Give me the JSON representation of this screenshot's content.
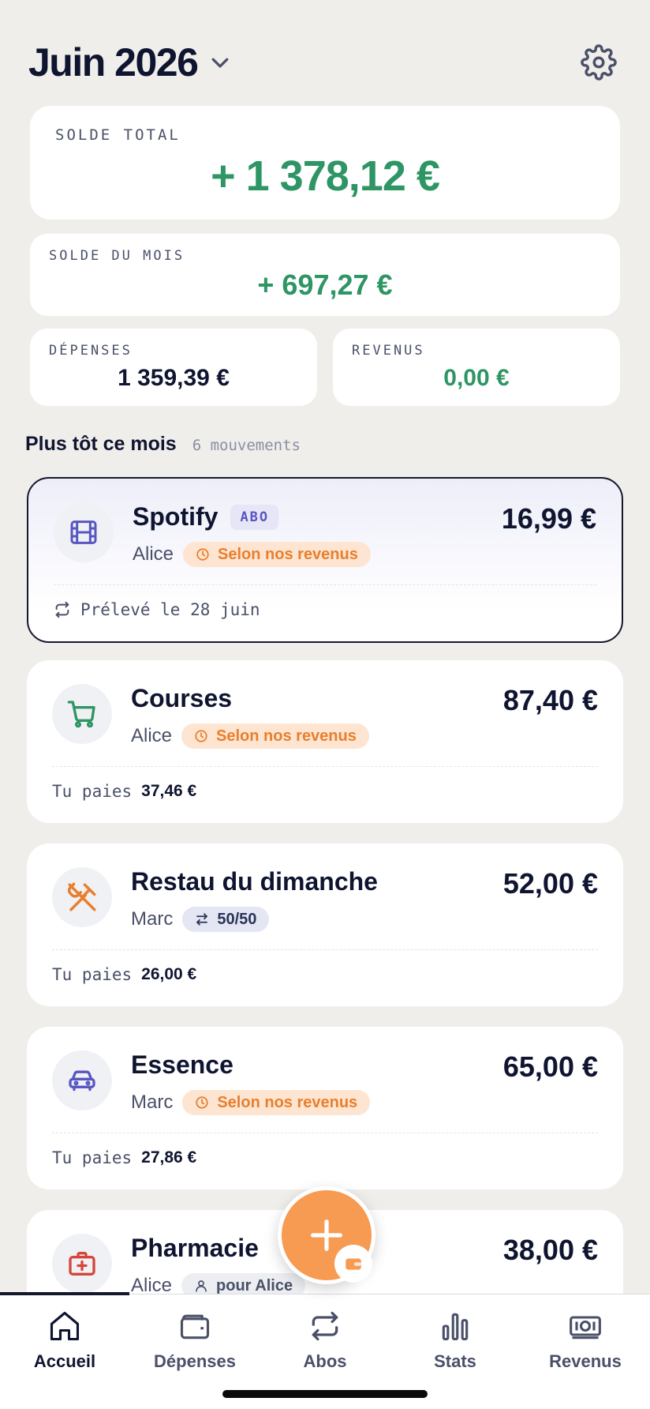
{
  "header": {
    "month": "Juin 2026"
  },
  "summary": {
    "total_label": "SOLDE TOTAL",
    "total_value": "+ 1 378,12 €",
    "month_label": "SOLDE DU MOIS",
    "month_value": "+ 697,27 €",
    "expenses_label": "DÉPENSES",
    "expenses_value": "1 359,39 €",
    "income_label": "REVENUS",
    "income_value": "0,00 €"
  },
  "section": {
    "title": "Plus tôt ce mois",
    "count": "6 mouvements"
  },
  "expenses": [
    {
      "name": "Spotify",
      "tag": "ABO",
      "amount": "16,99 €",
      "who": "Alice",
      "split": "Selon nos revenus",
      "footer_text": "Prélevé le 28 juin",
      "icon": "film-icon"
    },
    {
      "name": "Courses",
      "amount": "87,40 €",
      "who": "Alice",
      "split": "Selon nos revenus",
      "footer_label": "Tu paies",
      "footer_value": "37,46 €",
      "icon": "cart-icon"
    },
    {
      "name": "Restau du dimanche",
      "amount": "52,00 €",
      "who": "Marc",
      "split": "50/50",
      "footer_label": "Tu paies",
      "footer_value": "26,00 €",
      "icon": "utensils-icon"
    },
    {
      "name": "Essence",
      "amount": "65,00 €",
      "who": "Marc",
      "split": "Selon nos revenus",
      "footer_label": "Tu paies",
      "footer_value": "27,86 €",
      "icon": "car-icon"
    },
    {
      "name": "Pharmacie",
      "amount": "38,00 €",
      "who": "Alice",
      "split": "pour Alice",
      "icon": "medkit-icon"
    }
  ],
  "nav": [
    {
      "label": "Accueil",
      "icon": "home-icon",
      "active": true
    },
    {
      "label": "Dépenses",
      "icon": "wallet-icon"
    },
    {
      "label": "Abos",
      "icon": "repeat-icon"
    },
    {
      "label": "Stats",
      "icon": "bar-chart-icon"
    },
    {
      "label": "Revenus",
      "icon": "banknote-icon"
    }
  ],
  "colors": {
    "green": "#2e9564",
    "orange": "#e87f2e",
    "fab": "#f79a52",
    "navy": "#0f1530",
    "purple": "#5856c2"
  }
}
